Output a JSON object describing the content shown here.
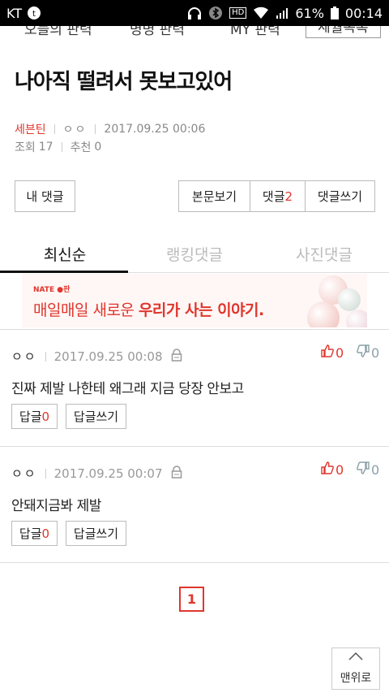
{
  "statusbar": {
    "carrier": "KT",
    "battery": "61%",
    "time": "00:14",
    "hd": "HD"
  },
  "topnav": {
    "item1": "오늘의 판력",
    "item2": "명명 판력",
    "item3": "MY 판력",
    "item4": "세월목록"
  },
  "post": {
    "title": "나아직 떨려서 못보고있어",
    "author": "세븐틴",
    "nick": "ㅇㅇ",
    "date": "2017.09.25 00:06",
    "views_label": "조회",
    "views": "17",
    "recommend_label": "추천",
    "recommend": "0"
  },
  "buttons": {
    "my_comments": "내 댓글",
    "view_body": "본문보기",
    "comments_label": "댓글",
    "comments_count": "2",
    "write_comment": "댓글쓰기"
  },
  "tabs": [
    "최신순",
    "랭킹댓글",
    "사진댓글"
  ],
  "banner": {
    "brand": "NATE ●판",
    "text_normal": "매일매일 새로운 ",
    "text_bold": "우리가 사는 이야기."
  },
  "comments": [
    {
      "author": "ㅇㅇ",
      "date": "2017.09.25 00:08",
      "text": "진짜 제발 나한테 왜그래 지금 당장 안보고",
      "up": "0",
      "down": "0",
      "reply_label": "답글",
      "reply_count": "0",
      "reply_write": "답글쓰기"
    },
    {
      "author": "ㅇㅇ",
      "date": "2017.09.25 00:07",
      "text": "안돼지금봐 제발",
      "up": "0",
      "down": "0",
      "reply_label": "답글",
      "reply_count": "0",
      "reply_write": "답글쓰기"
    }
  ],
  "pagination": {
    "current": "1"
  },
  "to_top": "맨위로",
  "colors": {
    "accent": "#e0362d",
    "border": "#bbbbbb"
  }
}
